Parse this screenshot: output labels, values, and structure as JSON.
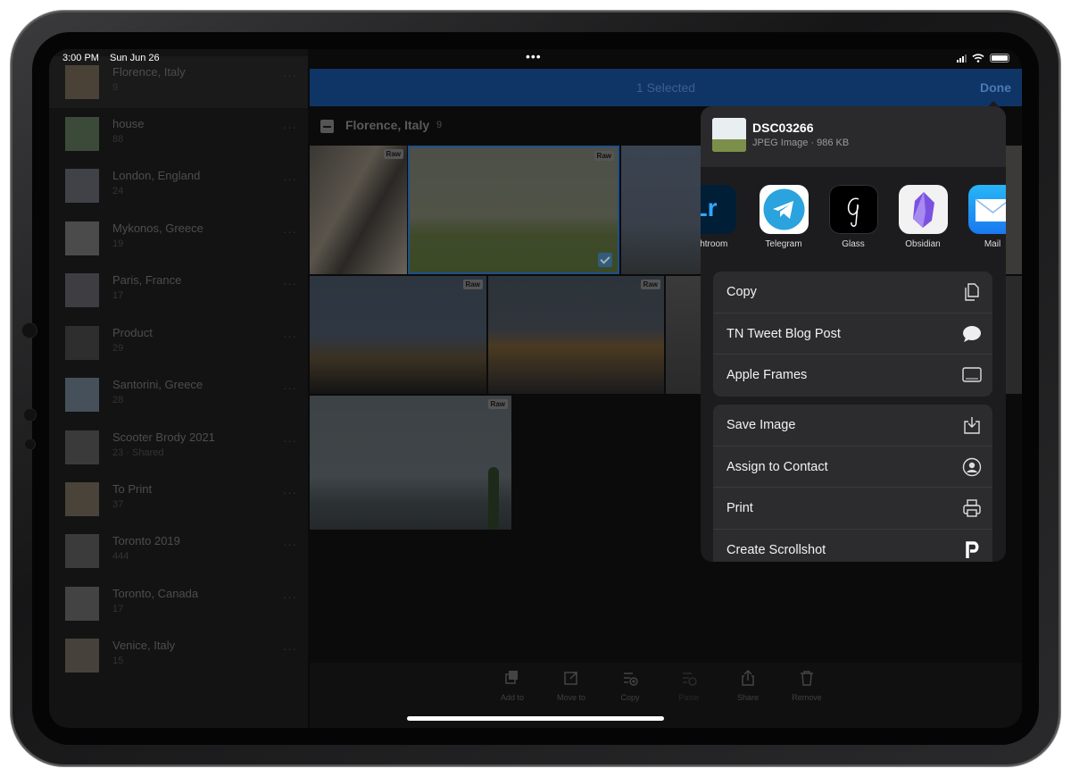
{
  "status": {
    "time": "3:00 PM",
    "date": "Sun Jun 26",
    "dots": "•••"
  },
  "sidebar": {
    "albums": [
      {
        "name": "Florence, Italy",
        "count": "9",
        "more": "···",
        "tone": "#4a4236"
      },
      {
        "name": "house",
        "count": "88",
        "more": "···",
        "tone": "#3c4a3a"
      },
      {
        "name": "London, England",
        "count": "24",
        "more": "···",
        "tone": "#404247"
      },
      {
        "name": "Mykonos, Greece",
        "count": "19",
        "more": "···",
        "tone": "#4b4b4b"
      },
      {
        "name": "Paris, France",
        "count": "17",
        "more": "···",
        "tone": "#3e3e42"
      },
      {
        "name": "Product",
        "count": "29",
        "more": "···",
        "tone": "#2e2e2e"
      },
      {
        "name": "Santorini, Greece",
        "count": "28",
        "more": "···",
        "tone": "#45505a"
      },
      {
        "name": "Scooter Brody 2021",
        "count": "23 · Shared",
        "more": "···",
        "tone": "#3a3a3a"
      },
      {
        "name": "To Print",
        "count": "37",
        "more": "···",
        "tone": "#494339"
      },
      {
        "name": "Toronto 2019",
        "count": "444",
        "more": "···",
        "tone": "#3b3b3b"
      },
      {
        "name": "Toronto, Canada",
        "count": "17",
        "more": "···",
        "tone": "#434343"
      },
      {
        "name": "Venice, Italy",
        "count": "15",
        "more": "···",
        "tone": "#46413a"
      }
    ]
  },
  "topbar": {
    "selected": "1 Selected",
    "done": "Done"
  },
  "section": {
    "title": "Florence, Italy",
    "count": "9"
  },
  "raw_badge": "Raw",
  "toolbar": {
    "items": [
      {
        "label": "Add to",
        "icon": "add-to-icon"
      },
      {
        "label": "Move to",
        "icon": "move-to-icon"
      },
      {
        "label": "Copy",
        "icon": "copy-settings-icon"
      },
      {
        "label": "Paste",
        "icon": "paste-settings-icon"
      },
      {
        "label": "Share",
        "icon": "share-icon"
      },
      {
        "label": "Remove",
        "icon": "trash-icon"
      }
    ]
  },
  "share_sheet": {
    "file_name": "DSC03266",
    "file_meta": "JPEG Image · 986 KB",
    "apps": [
      {
        "label": "ghtroom",
        "icon": "lightroom-icon",
        "color": "#001e36"
      },
      {
        "label": "Telegram",
        "icon": "telegram-icon",
        "color": "#2aa3de"
      },
      {
        "label": "Glass",
        "icon": "glass-icon",
        "color": "#000000"
      },
      {
        "label": "Obsidian",
        "icon": "obsidian-icon",
        "color": "#ffffff"
      },
      {
        "label": "Mail",
        "icon": "mail-icon",
        "color": "#1e8df7"
      }
    ],
    "lightroom_text": "Lr",
    "group1": [
      {
        "label": "Copy",
        "icon": "copy-icon"
      },
      {
        "label": "TN Tweet Blog Post",
        "icon": "speech-bubble-icon"
      },
      {
        "label": "Apple Frames",
        "icon": "tablet-frame-icon"
      }
    ],
    "group2": [
      {
        "label": "Save Image",
        "icon": "save-image-icon"
      },
      {
        "label": "Assign to Contact",
        "icon": "contact-icon"
      },
      {
        "label": "Print",
        "icon": "printer-icon"
      },
      {
        "label": "Create Scrollshot",
        "icon": "scrollshot-icon"
      }
    ]
  }
}
